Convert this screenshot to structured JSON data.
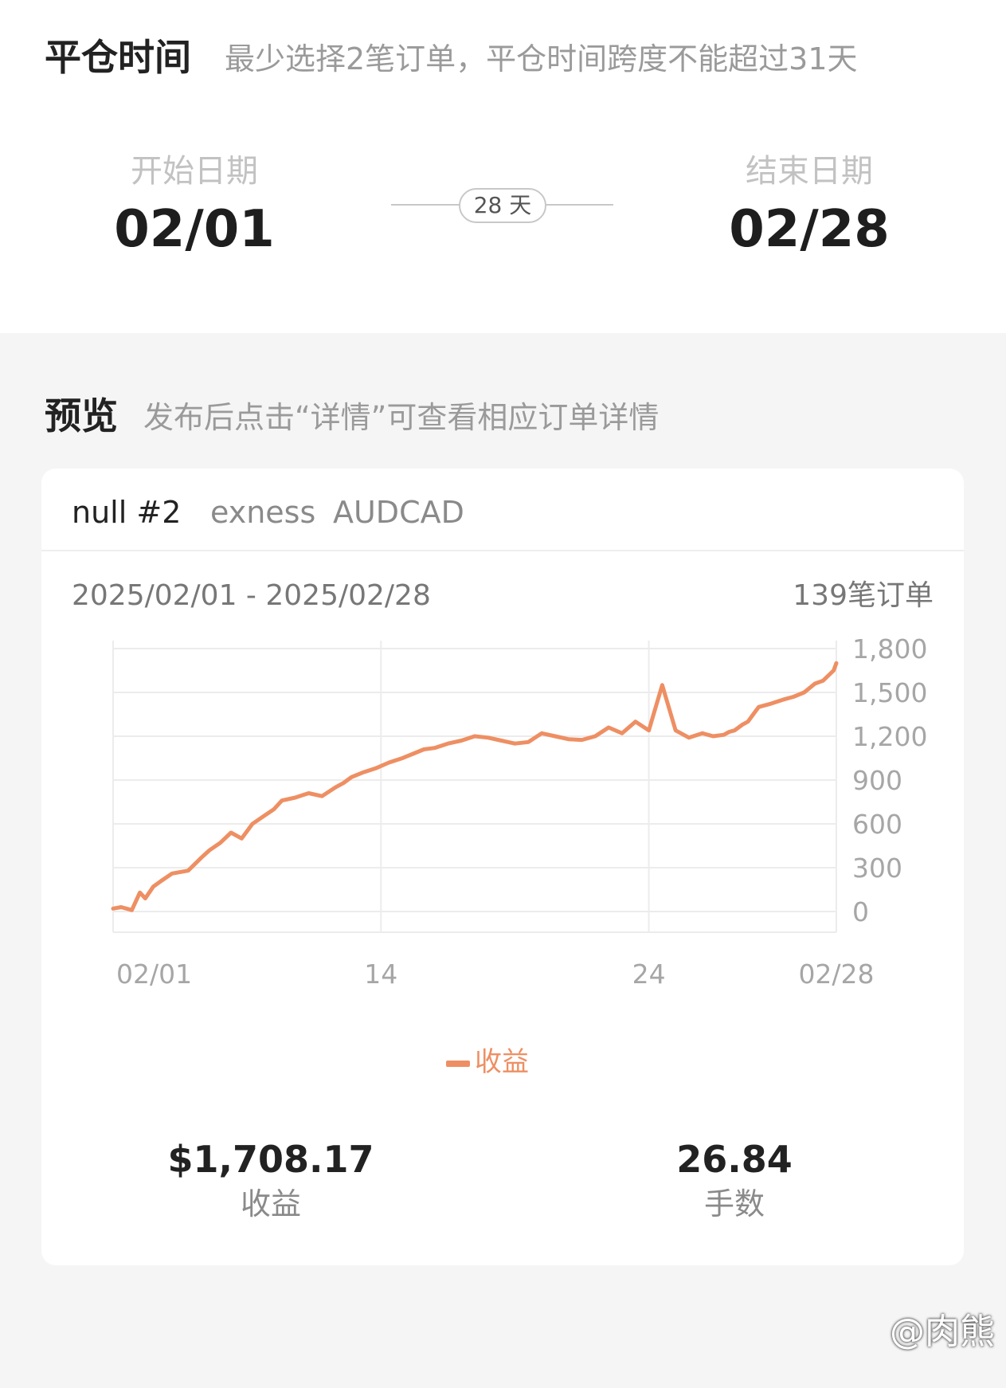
{
  "close_time": {
    "title": "平仓时间",
    "hint": "最少选择2笔订单，平仓时间跨度不能超过31天",
    "start_label": "开始日期",
    "start_value": "02/01",
    "end_label": "结束日期",
    "end_value": "02/28",
    "duration": "28 天"
  },
  "preview": {
    "title": "预览",
    "hint": "发布后点击“详情”可查看相应订单详情"
  },
  "card": {
    "account_name": "null #2",
    "broker": "exness",
    "symbol": "AUDCAD",
    "date_range": "2025/02/01 - 2025/02/28",
    "order_count": "139笔订单",
    "stats": {
      "profit_value": "$1,708.17",
      "profit_label": "收益",
      "lots_value": "26.84",
      "lots_label": "手数"
    }
  },
  "chart_data": {
    "type": "line",
    "x_tick_labels": [
      "02/01",
      "14",
      "24",
      "02/28"
    ],
    "y_tick_labels": [
      "1,800",
      "1,500",
      "1,200",
      "900",
      "600",
      "300",
      "0"
    ],
    "ylim": [
      0,
      1800
    ],
    "xlim": [
      1,
      28
    ],
    "grid": true,
    "legend": "bottom-center",
    "series": [
      {
        "name": "收益",
        "color": "#ee8f63",
        "x": [
          1,
          1.3,
          1.7,
          2.0,
          2.2,
          2.5,
          2.8,
          3.2,
          3.8,
          4.3,
          4.6,
          5.0,
          5.4,
          5.8,
          6.2,
          6.6,
          7.0,
          7.3,
          7.8,
          8.3,
          8.8,
          9.3,
          9.6,
          9.9,
          10.3,
          10.8,
          11.3,
          11.8,
          12.2,
          12.6,
          13.0,
          13.5,
          14.0,
          14.5,
          15.0,
          15.5,
          16.0,
          16.5,
          17.0,
          17.5,
          18.0,
          18.5,
          19.0,
          19.5,
          20.0,
          20.5,
          21.0,
          21.5,
          22.0,
          22.5,
          23.0,
          23.4,
          23.8,
          24.0,
          24.2,
          24.5,
          24.7,
          24.9,
          25.1,
          25.5,
          26.0,
          26.4,
          26.8,
          27.2,
          27.5,
          27.9,
          28.0
        ],
        "y": [
          20,
          30,
          10,
          130,
          90,
          170,
          210,
          260,
          280,
          370,
          420,
          470,
          540,
          500,
          600,
          650,
          700,
          760,
          780,
          810,
          790,
          850,
          880,
          920,
          950,
          980,
          1020,
          1050,
          1080,
          1110,
          1120,
          1150,
          1170,
          1200,
          1190,
          1170,
          1150,
          1160,
          1220,
          1200,
          1180,
          1175,
          1200,
          1260,
          1220,
          1300,
          1240,
          1550,
          1240,
          1190,
          1220,
          1200,
          1210,
          1230,
          1240,
          1280,
          1300,
          1350,
          1400,
          1420,
          1450,
          1470,
          1500,
          1560,
          1580,
          1650,
          1700
        ]
      }
    ]
  },
  "watermark": "@肉熊"
}
